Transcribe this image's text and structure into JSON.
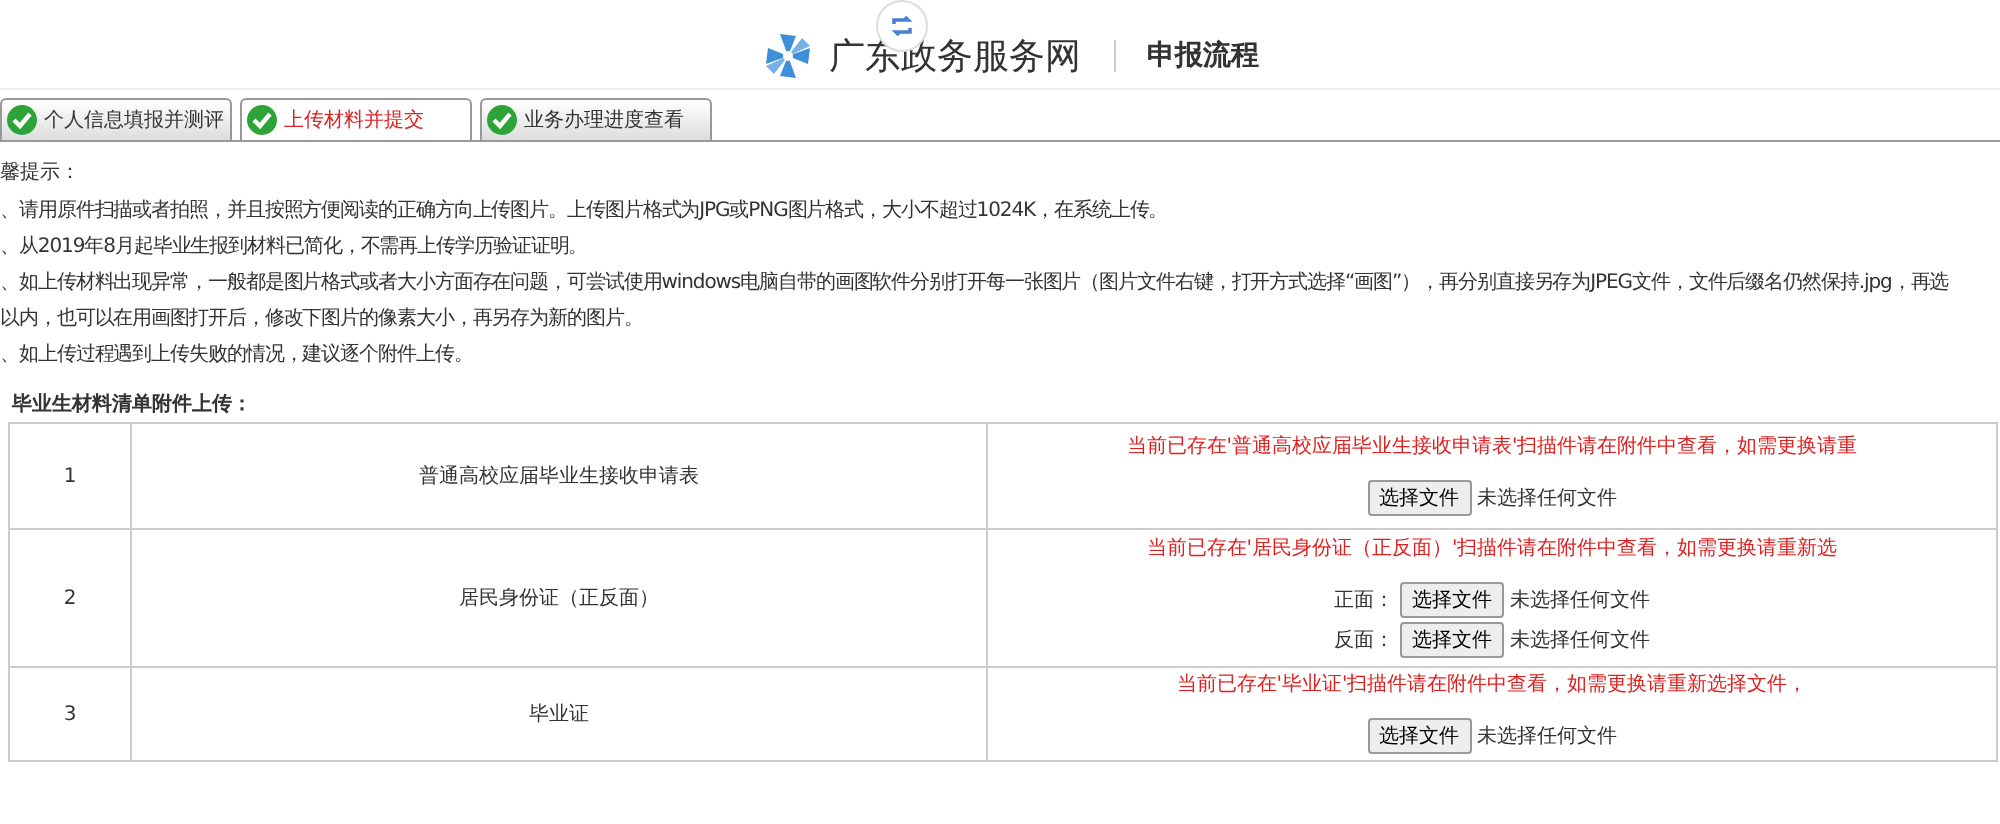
{
  "header": {
    "site_name": "广东政务服务网",
    "page_title": "申报流程"
  },
  "tabs": [
    {
      "label": "个人信息填报并测评",
      "selected": false,
      "done": true
    },
    {
      "label": "上传材料并提交",
      "selected": true,
      "done": true
    },
    {
      "label": "业务办理进度查看",
      "selected": false,
      "done": true
    }
  ],
  "notes": {
    "title": "馨提示：",
    "lines": [
      "、请用原件扫描或者拍照，并且按照方便阅读的正确方向上传图片。上传图片格式为JPG或PNG图片格式，大小不超过1024K，在系统上传。",
      "、从2019年8月起毕业生报到材料已简化，不需再上传学历验证证明。",
      "、如上传材料出现异常，一般都是图片格式或者大小方面存在问题，可尝试使用windows电脑自带的画图软件分别打开每一张图片（图片文件右键，打开方式选择“画图”），再分别直接另存为JPEG文件，文件后缀名仍然保持.jpg，再选",
      "以内，也可以在用画图打开后，修改下图片的像素大小，再另存为新的图片。",
      "、如上传过程遇到上传失败的情况，建议逐个附件上传。"
    ]
  },
  "materials": {
    "title": "毕业生材料清单附件上传：",
    "rows": [
      {
        "number": "1",
        "name": "普通高校应届毕业生接收申请表",
        "notice": "当前已存在'普通高校应届毕业生接收申请表'扫描件请在附件中查看，如需更换请重",
        "uploads": [
          {
            "button": "选择文件",
            "status": "未选择任何文件"
          }
        ]
      },
      {
        "number": "2",
        "name": "居民身份证（正反面）",
        "notice": "当前已存在'居民身份证（正反面）'扫描件请在附件中查看，如需更换请重新选",
        "uploads": [
          {
            "label": "正面：",
            "button": "选择文件",
            "status": "未选择任何文件"
          },
          {
            "label": "反面：",
            "button": "选择文件",
            "status": "未选择任何文件"
          }
        ]
      },
      {
        "number": "3",
        "name": "毕业证",
        "notice": "当前已存在'毕业证'扫描件请在附件中查看，如需更换请重新选择文件，",
        "uploads": [
          {
            "button": "选择文件",
            "status": "未选择任何文件"
          }
        ]
      }
    ]
  }
}
